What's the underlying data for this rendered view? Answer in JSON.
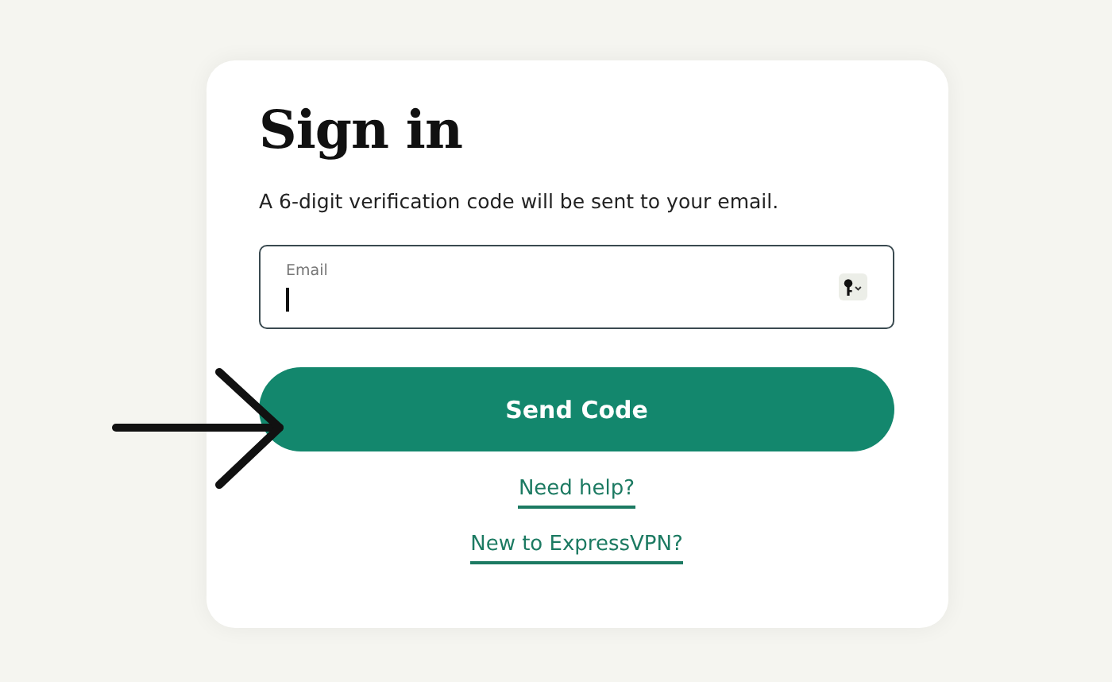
{
  "card": {
    "title": "Sign in",
    "subtitle": "A 6-digit verification code will be sent to your email.",
    "email_field": {
      "label": "Email",
      "focused": true
    },
    "submit_button": "Send Code",
    "links": [
      "Need help?",
      "New to ExpressVPN?"
    ]
  },
  "annotation": {
    "kind": "arrow"
  }
}
